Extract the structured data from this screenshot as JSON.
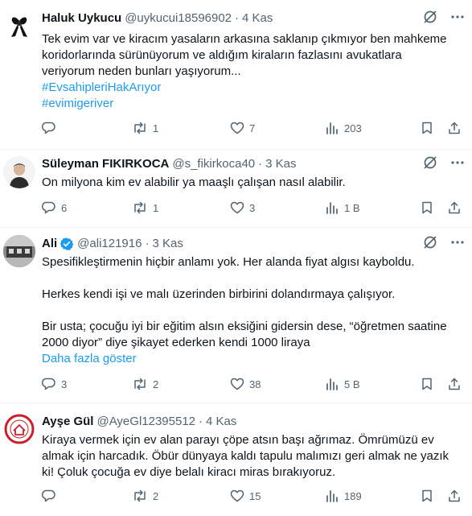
{
  "tweets": [
    {
      "name": "Haluk Uykucu",
      "handle": "@uykucui18596902",
      "time": "4 Kas",
      "lines": [
        "Tek evim var ve kiracım yasaların arkasına saklanıp çıkmıyor ben mahkeme",
        "koridorlarında sürünüyorum ve aldığım kiraların fazlasını avukatlara",
        "veriyorum neden bunları yaşıyorum..."
      ],
      "hashtags": [
        "#EvsahipleriHakArıyor",
        "#evimigeriver"
      ],
      "replies": "",
      "retweets": "1",
      "likes": "7",
      "views": "203"
    },
    {
      "name": "Süleyman FIKIRKOCA",
      "handle": "@s_fikirkoca40",
      "time": "3 Kas",
      "lines": [
        "On milyona kim ev alabilir ya maaşlı çalışan nasıl alabilir."
      ],
      "replies": "6",
      "retweets": "1",
      "likes": "3",
      "views": "1 B"
    },
    {
      "name": "Ali",
      "handle": "@ali121916",
      "time": "3 Kas",
      "para1": "Spesifikleştirmenin hiçbir anlamı yok. Her alanda fiyat algısı kayboldu.",
      "para2": "Herkes kendi işi ve malı üzerinden birbirini dolandırmaya çalışıyor.",
      "para3_line1": "Bir usta; çocuğu iyi bir eğitim alsın eksiğini gidersin dese, “öğretmen saatine",
      "para3_line2": "2000 diyor” diye şikayet ederken kendi 1000 liraya",
      "show_more": "Daha fazla göster",
      "replies": "3",
      "retweets": "2",
      "likes": "38",
      "views": "5 B"
    },
    {
      "name": "Ayşe Gül",
      "handle": "@AyeGl12395512",
      "time": "4 Kas",
      "lines": [
        "Kiraya vermek için ev alan parayı çöpe atsın başı ağrımaz. Ömrümüzü ev",
        "almak için harcadık. Öbür dünyaya kaldı tapulu malımızı geri almak ne yazık",
        "ki! Çoluk çocuğa ev diye belalı kiracı miras bırakıyoruz."
      ],
      "replies": "",
      "retweets": "2",
      "likes": "15",
      "views": "189"
    }
  ],
  "colors": {
    "text": "#0f1419",
    "muted": "#536471",
    "link": "#1d9bf0",
    "verified": "#1d9bf0",
    "divider": "#eff3f4"
  },
  "icons": [
    "grok-icon",
    "more-icon",
    "reply-icon",
    "retweet-icon",
    "like-icon",
    "views-icon",
    "bookmark-icon",
    "share-icon",
    "verified-badge-icon"
  ]
}
